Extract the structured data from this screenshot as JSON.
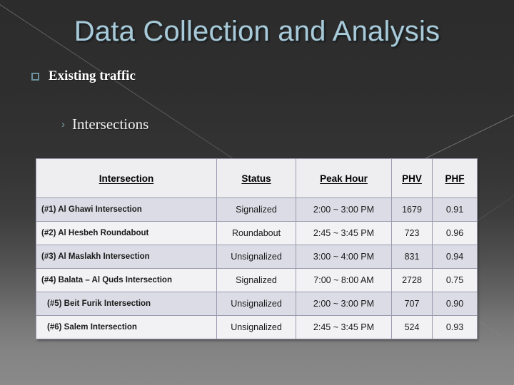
{
  "slide": {
    "title": "Data Collection and Analysis",
    "title_color": "#a9cad9",
    "background_top_color": "#2c2c2c",
    "background_bottom_color": "#8a8a8a"
  },
  "bullets": {
    "level1": {
      "marker": "square-outline-bullet",
      "text": "Existing traffic",
      "color": "#ffffff",
      "marker_color": "#6c919e"
    },
    "level2": {
      "marker": "chevron-right-bullet",
      "text": "Intersections",
      "color": "#f2f2f2",
      "marker_color": "#7e9fab"
    }
  },
  "table": {
    "headers": [
      "Intersection",
      "Status",
      "Peak Hour",
      "PHV",
      "PHF"
    ],
    "header_bg": "#eeeef1",
    "row_alt_bg": "#dcdce6",
    "row_plain_bg": "#f2f2f5",
    "border_color": "#9a9aae",
    "rows": [
      {
        "intersection": "(#1) Al Ghawi Intersection",
        "status": "Signalized",
        "peak_hour": "2:00 ~ 3:00 PM",
        "phv": "1679",
        "phf": "0.91",
        "indented": false
      },
      {
        "intersection": "(#2) Al Hesbeh Roundabout",
        "status": "Roundabout",
        "peak_hour": "2:45 ~ 3:45 PM",
        "phv": "723",
        "phf": "0.96",
        "indented": false
      },
      {
        "intersection": "(#3) Al Maslakh Intersection",
        "status": "Unsignalized",
        "peak_hour": "3:00 ~ 4:00 PM",
        "phv": "831",
        "phf": "0.94",
        "indented": false
      },
      {
        "intersection": "(#4) Balata – Al Quds Intersection",
        "status": "Signalized",
        "peak_hour": "7:00 ~ 8:00 AM",
        "phv": "2728",
        "phf": "0.75",
        "indented": false
      },
      {
        "intersection": "(#5) Beit Furik Intersection",
        "status": "Unsignalized",
        "peak_hour": "2:00 ~ 3:00 PM",
        "phv": "707",
        "phf": "0.90",
        "indented": true
      },
      {
        "intersection": "(#6) Salem Intersection",
        "status": "Unsignalized",
        "peak_hour": "2:45 ~ 3:45 PM",
        "phv": "524",
        "phf": "0.93",
        "indented": true
      }
    ]
  }
}
